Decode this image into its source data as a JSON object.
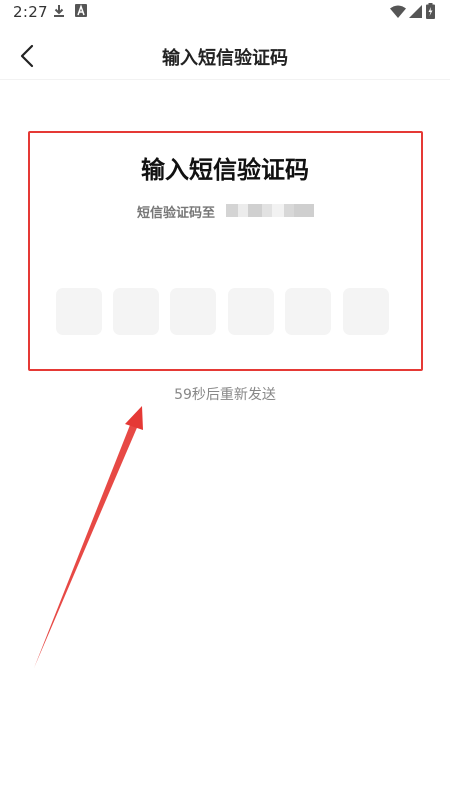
{
  "status_bar": {
    "time": "2:27",
    "icons": [
      "download-icon",
      "a-badge-icon",
      "wifi-icon",
      "signal-icon",
      "battery-icon"
    ]
  },
  "header": {
    "title": "输入短信验证码",
    "back_icon": "chevron-left-icon"
  },
  "verify": {
    "heading": "输入短信验证码",
    "sent_to_label": "短信验证码至",
    "code_length": 6,
    "resend_text": "59秒后重新发送"
  },
  "colors": {
    "highlight_border": "#e53935",
    "code_box_bg": "#f4f4f4",
    "muted_text": "#888888"
  }
}
